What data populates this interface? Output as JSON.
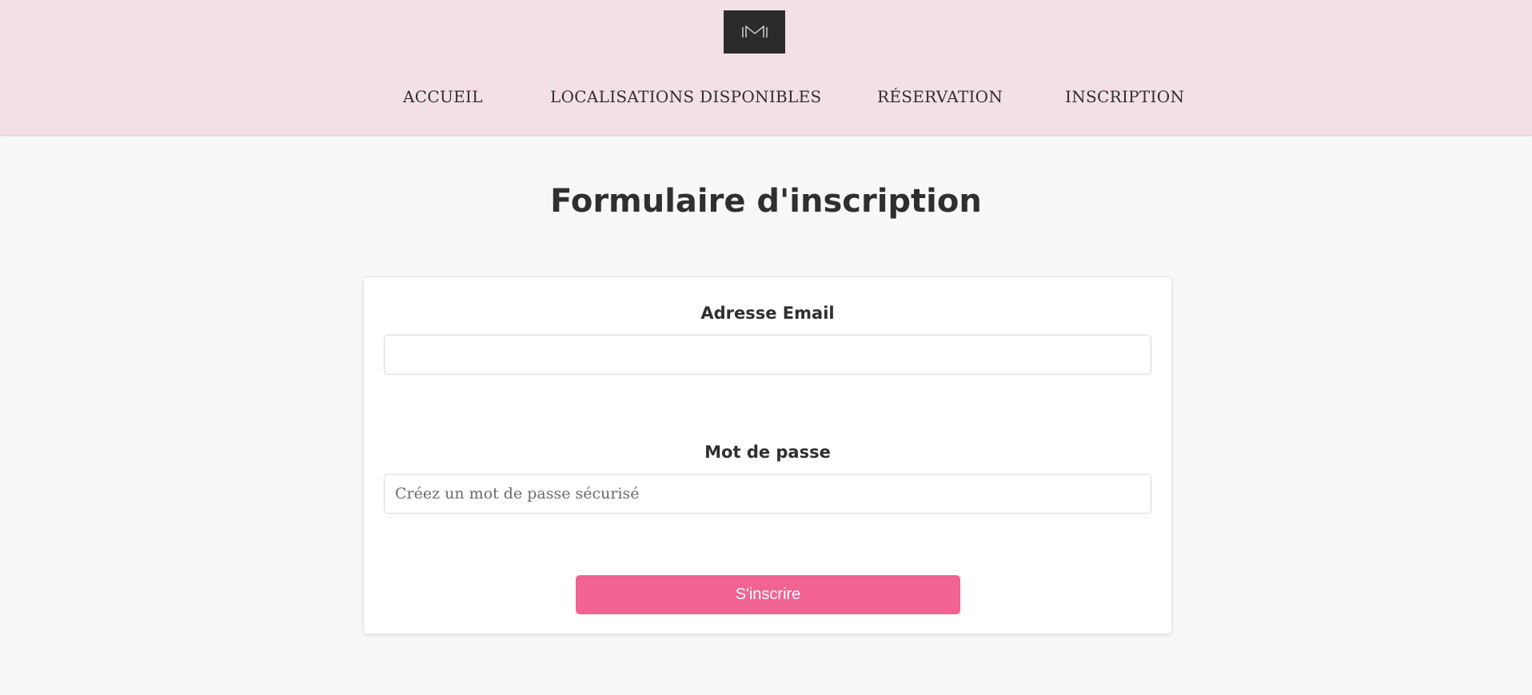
{
  "header": {
    "logo_icon": "m-logo-icon",
    "logo_bg": "#2b2b2b",
    "background": "#f3e0e6",
    "nav": [
      {
        "label": "ACCUEIL"
      },
      {
        "label": "LOCALISATIONS DISPONIBLES"
      },
      {
        "label": "RÉSERVATION"
      },
      {
        "label": "INSCRIPTION"
      }
    ]
  },
  "main": {
    "title": "Formulaire d'inscription"
  },
  "form": {
    "email_label": "Adresse Email",
    "email_value": "",
    "email_placeholder": "",
    "password_label": "Mot de passe",
    "password_value": "",
    "password_placeholder": "Créez un mot de passe sécurisé",
    "submit_label": "S'inscrire",
    "submit_color": "#f06392"
  }
}
